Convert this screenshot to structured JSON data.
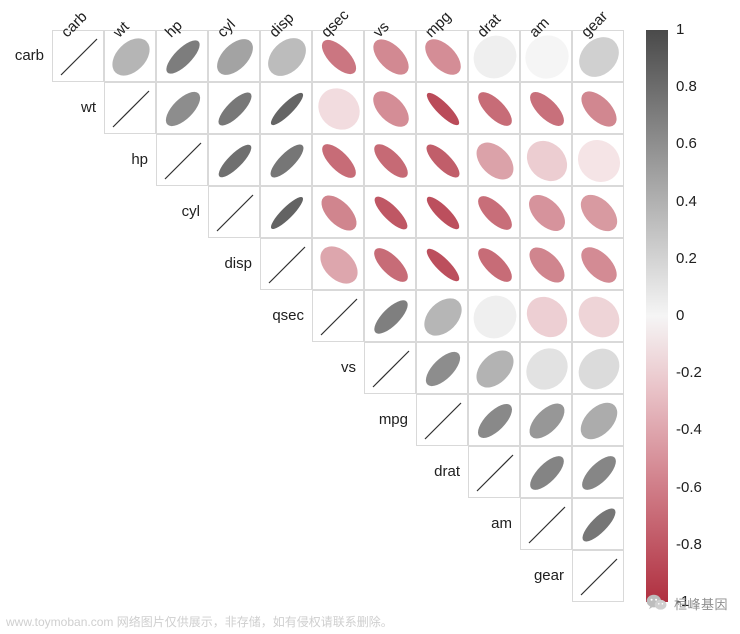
{
  "chart_data": {
    "type": "heatmap",
    "title": "",
    "xlabel": "",
    "ylabel": "",
    "labels": [
      "carb",
      "wt",
      "hp",
      "cyl",
      "disp",
      "qsec",
      "vs",
      "mpg",
      "drat",
      "am",
      "gear"
    ],
    "matrix": [
      [
        1.0,
        0.43,
        0.75,
        0.53,
        0.39,
        -0.66,
        -0.57,
        -0.55,
        0.09,
        0.06,
        0.27
      ],
      [
        null,
        1.0,
        0.66,
        0.78,
        0.89,
        -0.17,
        -0.55,
        -0.87,
        -0.71,
        -0.69,
        -0.58
      ],
      [
        null,
        null,
        1.0,
        0.83,
        0.79,
        -0.71,
        -0.72,
        -0.78,
        -0.45,
        -0.24,
        -0.13
      ],
      [
        null,
        null,
        null,
        1.0,
        0.9,
        -0.59,
        -0.81,
        -0.85,
        -0.7,
        -0.52,
        -0.49
      ],
      [
        null,
        null,
        null,
        null,
        1.0,
        -0.43,
        -0.71,
        -0.85,
        -0.71,
        -0.59,
        -0.56
      ],
      [
        null,
        null,
        null,
        null,
        null,
        1.0,
        0.74,
        0.42,
        0.09,
        -0.23,
        -0.21
      ],
      [
        null,
        null,
        null,
        null,
        null,
        null,
        1.0,
        0.66,
        0.44,
        0.17,
        0.21
      ],
      [
        null,
        null,
        null,
        null,
        null,
        null,
        null,
        1.0,
        0.68,
        0.6,
        0.48
      ],
      [
        null,
        null,
        null,
        null,
        null,
        null,
        null,
        null,
        1.0,
        0.71,
        0.7
      ],
      [
        null,
        null,
        null,
        null,
        null,
        null,
        null,
        null,
        null,
        1.0,
        0.79
      ],
      [
        null,
        null,
        null,
        null,
        null,
        null,
        null,
        null,
        null,
        null,
        1.0
      ]
    ],
    "colorbar_ticks": [
      "1",
      "0.8",
      "0.6",
      "0.4",
      "0.2",
      "0",
      "-0.2",
      "-0.4",
      "-0.6",
      "-0.8",
      "-1"
    ],
    "colorbar_range": [
      -1,
      1
    ],
    "style": "upper-triangle-ellipse"
  },
  "watermark": {
    "icon": "wechat",
    "text": "桓峰基因"
  },
  "footer_text": "www.toymoban.com 网络图片仅供展示，非存储，如有侵权请联系删除。"
}
